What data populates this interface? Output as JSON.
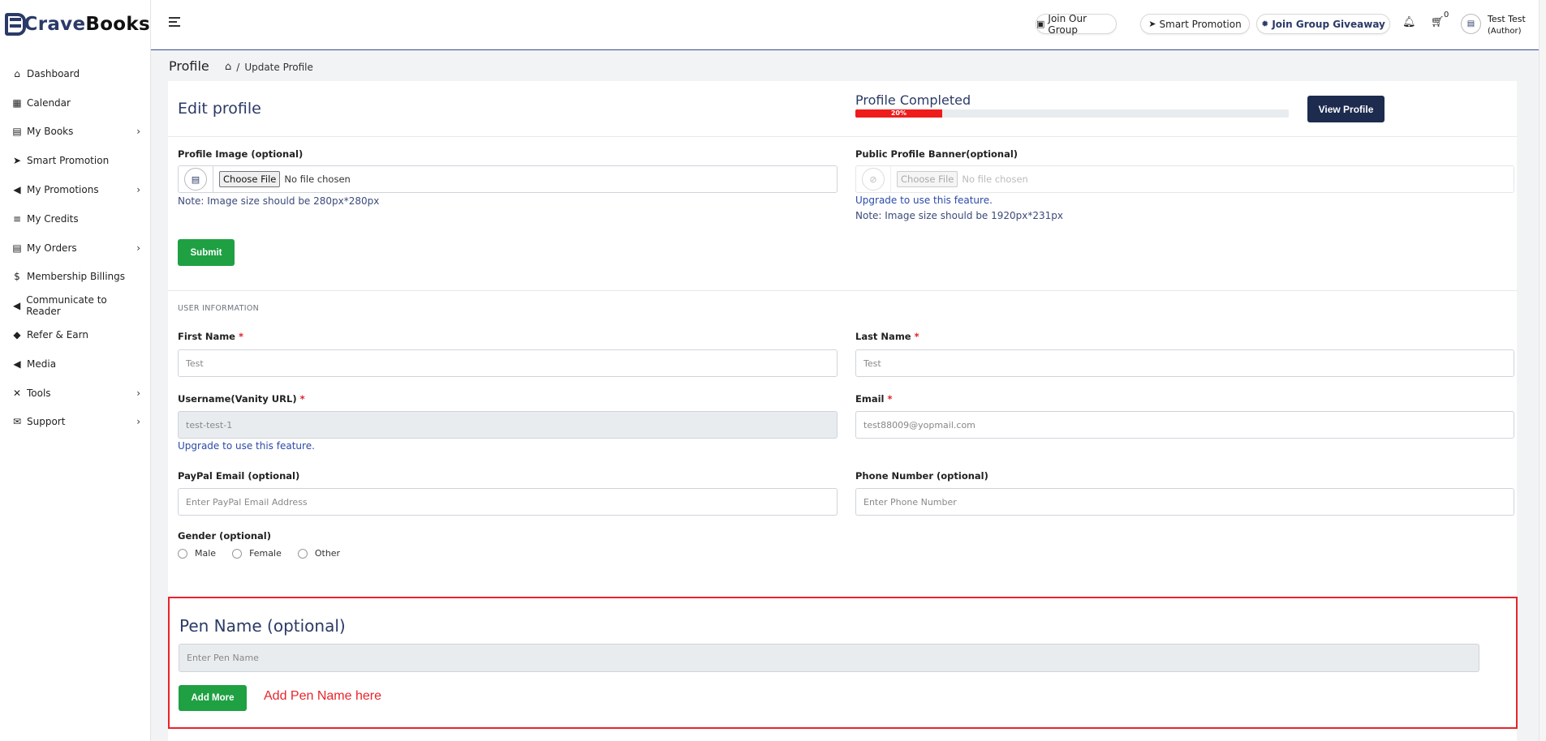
{
  "brand": {
    "part1": "Crave",
    "part2": "Books"
  },
  "sidebar": {
    "items": [
      {
        "label": "Dashboard",
        "icon": "store-icon",
        "glyph": "⌂",
        "has_children": false
      },
      {
        "label": "Calendar",
        "icon": "calendar-icon",
        "glyph": "▦",
        "has_children": false
      },
      {
        "label": "My Books",
        "icon": "book-icon",
        "glyph": "▤",
        "has_children": true
      },
      {
        "label": "Smart Promotion",
        "icon": "paper-plane-icon",
        "glyph": "➤",
        "has_children": false
      },
      {
        "label": "My Promotions",
        "icon": "megaphone-icon",
        "glyph": "◀",
        "has_children": true
      },
      {
        "label": "My Credits",
        "icon": "coins-icon",
        "glyph": "≡",
        "has_children": false
      },
      {
        "label": "My Orders",
        "icon": "orders-icon",
        "glyph": "▤",
        "has_children": true
      },
      {
        "label": "Membership Billings",
        "icon": "money-bill-icon",
        "glyph": "$",
        "has_children": false
      },
      {
        "label": "Communicate to Reader",
        "icon": "bullhorn-icon",
        "glyph": "◀",
        "has_children": false
      },
      {
        "label": "Refer & Earn",
        "icon": "gem-icon",
        "glyph": "◆",
        "has_children": false
      },
      {
        "label": "Media",
        "icon": "volume-icon",
        "glyph": "◀",
        "has_children": false
      },
      {
        "label": "Tools",
        "icon": "tools-icon",
        "glyph": "✕",
        "has_children": true
      },
      {
        "label": "Support",
        "icon": "envelope-icon",
        "glyph": "✉",
        "has_children": true
      }
    ]
  },
  "topbar": {
    "join_group": "Join Our Group",
    "smart_promotion": "Smart Promotion",
    "giveaway": "Join Group Giveaway",
    "cart_count": "0",
    "user_name": "Test Test",
    "user_role": "(Author)"
  },
  "page": {
    "title": "Profile",
    "breadcrumb_current": "Update Profile"
  },
  "profile": {
    "edit_title": "Edit profile",
    "completed_title": "Profile Completed",
    "completed_percent": 20,
    "completed_label": "20%",
    "view_button": "View Profile",
    "image_label": "Profile Image (optional)",
    "choose_file": "Choose File",
    "no_file": "No file chosen",
    "image_note": "Note: Image size should be 280px*280px",
    "banner_label": "Public Profile Banner(optional)",
    "banner_upgrade": "Upgrade to use this feature.",
    "banner_note": "Note: Image size should be 1920px*231px",
    "submit": "Submit"
  },
  "user_info": {
    "section_title": "USER INFORMATION",
    "first_name_label": "First Name",
    "first_name_value": "Test",
    "last_name_label": "Last Name",
    "last_name_value": "Test",
    "username_label": "Username(Vanity URL)",
    "username_value": "test-test-1",
    "username_upgrade": "Upgrade to use this feature.",
    "email_label": "Email",
    "email_value": "test88009@yopmail.com",
    "paypal_label": "PayPal Email (optional)",
    "paypal_placeholder": "Enter PayPal Email Address",
    "phone_label": "Phone Number (optional)",
    "phone_placeholder": "Enter Phone Number",
    "gender_label": "Gender (optional)",
    "gender_options": [
      "Male",
      "Female",
      "Other"
    ],
    "required_mark": "*"
  },
  "pen_name": {
    "title": "Pen Name (optional)",
    "placeholder": "Enter Pen Name",
    "add_more": "Add More",
    "annotation": "Add Pen Name here"
  },
  "colors": {
    "brand_navy": "#2b3a67",
    "button_dark": "#1d2b4f",
    "success_green": "#1fa043",
    "progress_red": "#ef1c1c",
    "highlight_red": "#e8242b"
  }
}
